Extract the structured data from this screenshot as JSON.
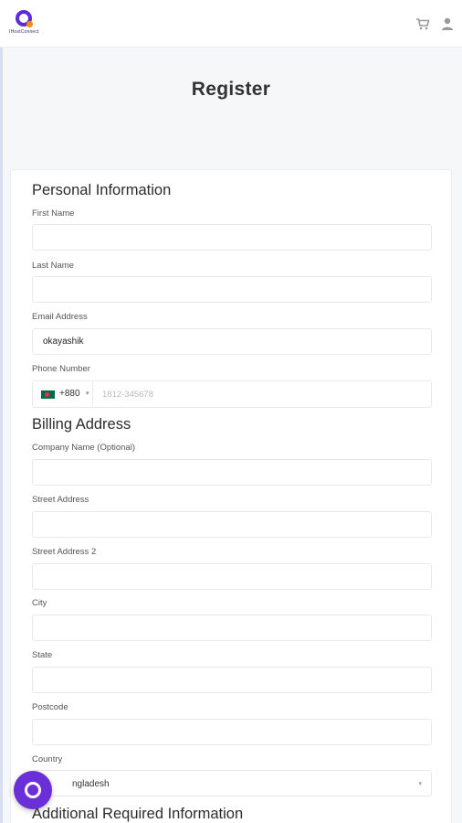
{
  "header": {
    "logo_text": "IHostConnect",
    "icons": [
      "cart-icon",
      "user-icon"
    ]
  },
  "page": {
    "title": "Register"
  },
  "personal": {
    "title": "Personal Information",
    "first_name": {
      "label": "First Name",
      "value": ""
    },
    "last_name": {
      "label": "Last Name",
      "value": ""
    },
    "email": {
      "label": "Email Address",
      "value": "okayashik"
    },
    "phone": {
      "label": "Phone Number",
      "country_code": "+880",
      "placeholder": "1812-345678",
      "value": ""
    }
  },
  "billing": {
    "title": "Billing Address",
    "company": {
      "label": "Company Name (Optional)",
      "value": ""
    },
    "street": {
      "label": "Street Address",
      "value": ""
    },
    "street2": {
      "label": "Street Address 2",
      "value": ""
    },
    "city": {
      "label": "City",
      "value": ""
    },
    "state": {
      "label": "State",
      "value": ""
    },
    "postcode": {
      "label": "Postcode",
      "value": ""
    },
    "country": {
      "label": "Country",
      "value": "nglades​h"
    }
  },
  "additional": {
    "title": "Additional Required Information"
  },
  "colors": {
    "brand": "#5b2bd6",
    "accent": "#ff8a00",
    "chat": "#6b2fd8"
  }
}
